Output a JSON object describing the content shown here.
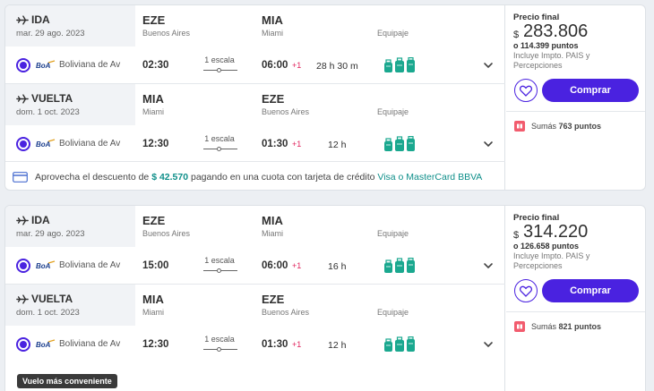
{
  "colors": {
    "accent": "#4a22e0",
    "teal": "#1aa88f",
    "plus_days": "#e0245e",
    "promo_highlight": "#0f8f8a"
  },
  "offers": [
    {
      "legs": [
        {
          "type": "IDA",
          "date": "mar. 29 ago. 2023",
          "origin_code": "EZE",
          "origin_city": "Buenos Aires",
          "dest_code": "MIA",
          "dest_city": "Miami",
          "equipment_label": "Equipaje",
          "airline": "Boliviana de Av",
          "depart": "02:30",
          "stops": "1 escala",
          "arrive": "06:00",
          "plus_days": "+1",
          "duration": "28 h 30 m"
        },
        {
          "type": "VUELTA",
          "date": "dom. 1 oct. 2023",
          "origin_code": "MIA",
          "origin_city": "Miami",
          "dest_code": "EZE",
          "dest_city": "Buenos Aires",
          "equipment_label": "Equipaje",
          "airline": "Boliviana de Av",
          "depart": "12:30",
          "stops": "1 escala",
          "arrive": "01:30",
          "plus_days": "+1",
          "duration": "12 h"
        }
      ],
      "promo": {
        "prefix": "Aprovecha el descuento de ",
        "amount": "$ 42.570",
        "middle": " pagando en una cuota con tarjeta de crédito ",
        "cards": "Visa o MasterCard BBVA"
      },
      "price": {
        "label": "Precio final",
        "currency": "$",
        "amount": "283.806",
        "points": "o 114.399 puntos",
        "includes": "Incluye Impto. PAIS y Percepciones",
        "buy_label": "Comprar",
        "earn_prefix": "Sumás ",
        "earn_points": "763 puntos"
      }
    },
    {
      "legs": [
        {
          "type": "IDA",
          "date": "mar. 29 ago. 2023",
          "origin_code": "EZE",
          "origin_city": "Buenos Aires",
          "dest_code": "MIA",
          "dest_city": "Miami",
          "equipment_label": "Equipaje",
          "airline": "Boliviana de Av",
          "depart": "15:00",
          "stops": "1 escala",
          "arrive": "06:00",
          "plus_days": "+1",
          "duration": "16 h"
        },
        {
          "type": "VUELTA",
          "date": "dom. 1 oct. 2023",
          "origin_code": "MIA",
          "origin_city": "Miami",
          "dest_code": "EZE",
          "dest_city": "Buenos Aires",
          "equipment_label": "Equipaje",
          "airline": "Boliviana de Av",
          "depart": "12:30",
          "stops": "1 escala",
          "arrive": "01:30",
          "plus_days": "+1",
          "duration": "12 h"
        }
      ],
      "badge": "Vuelo más conveniente",
      "price": {
        "label": "Precio final",
        "currency": "$",
        "amount": "314.220",
        "points": "o 126.658 puntos",
        "includes": "Incluye Impto. PAIS y Percepciones",
        "buy_label": "Comprar",
        "earn_prefix": "Sumás ",
        "earn_points": "821 puntos"
      }
    }
  ],
  "icons": [
    "plane-departure-icon",
    "plane-return-icon",
    "airline-logo",
    "luggage-icon",
    "chevron-down-icon",
    "credit-card-icon",
    "heart-icon",
    "gift-icon"
  ]
}
